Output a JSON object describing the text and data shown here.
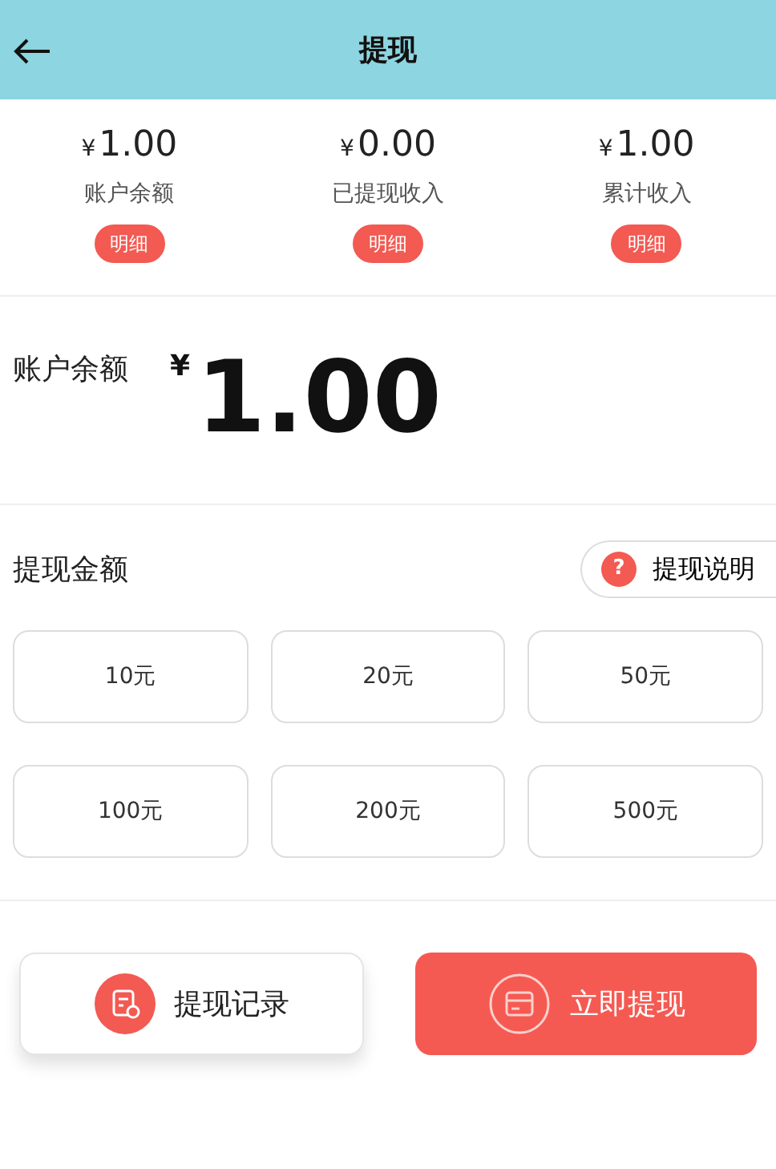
{
  "header": {
    "title": "提现"
  },
  "stats": [
    {
      "currency": "¥",
      "value": "1.00",
      "label": "账户余额",
      "button": "明细"
    },
    {
      "currency": "¥",
      "value": "0.00",
      "label": "已提现收入",
      "button": "明细"
    },
    {
      "currency": "¥",
      "value": "1.00",
      "label": "累计收入",
      "button": "明细"
    }
  ],
  "balance": {
    "label": "账户余额",
    "currency": "¥",
    "value": "1.00"
  },
  "amount_section": {
    "title": "提现金额",
    "help_icon": "?",
    "help": "提现说明",
    "options": [
      "10元",
      "20元",
      "50元",
      "100元",
      "200元",
      "500元"
    ]
  },
  "actions": [
    {
      "kind": "secondary",
      "label": "提现记录"
    },
    {
      "kind": "primary",
      "label": "立即提现"
    }
  ]
}
